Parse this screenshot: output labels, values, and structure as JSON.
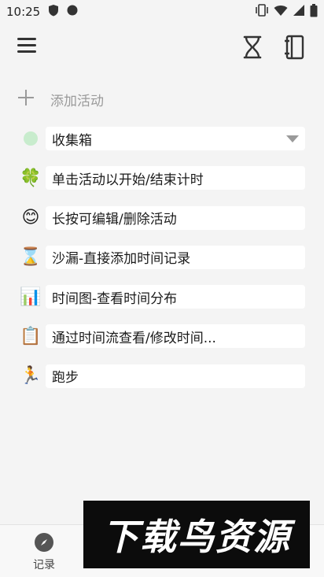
{
  "status_bar": {
    "time": "10:25"
  },
  "add_activity": {
    "label": "添加活动"
  },
  "activities": [
    {
      "emoji": "",
      "label": "收集箱"
    },
    {
      "emoji": "🍀",
      "label": "单击活动以开始/结束计时"
    },
    {
      "emoji": "😊",
      "label": "长按可编辑/删除活动"
    },
    {
      "emoji": "⌛",
      "label": "沙漏-直接添加时间记录"
    },
    {
      "emoji": "📊",
      "label": "时间图-查看时间分布"
    },
    {
      "emoji": "📋",
      "label": "通过时间流查看/修改时间..."
    },
    {
      "emoji": "🏃",
      "label": "跑步"
    }
  ],
  "bottom_nav": {
    "record_label": "记录"
  },
  "watermark": {
    "text": "下载鸟资源"
  },
  "colors": {
    "inbox_dot": "#c8eccd",
    "background": "#f4f4f4",
    "pill": "#ffffff"
  }
}
